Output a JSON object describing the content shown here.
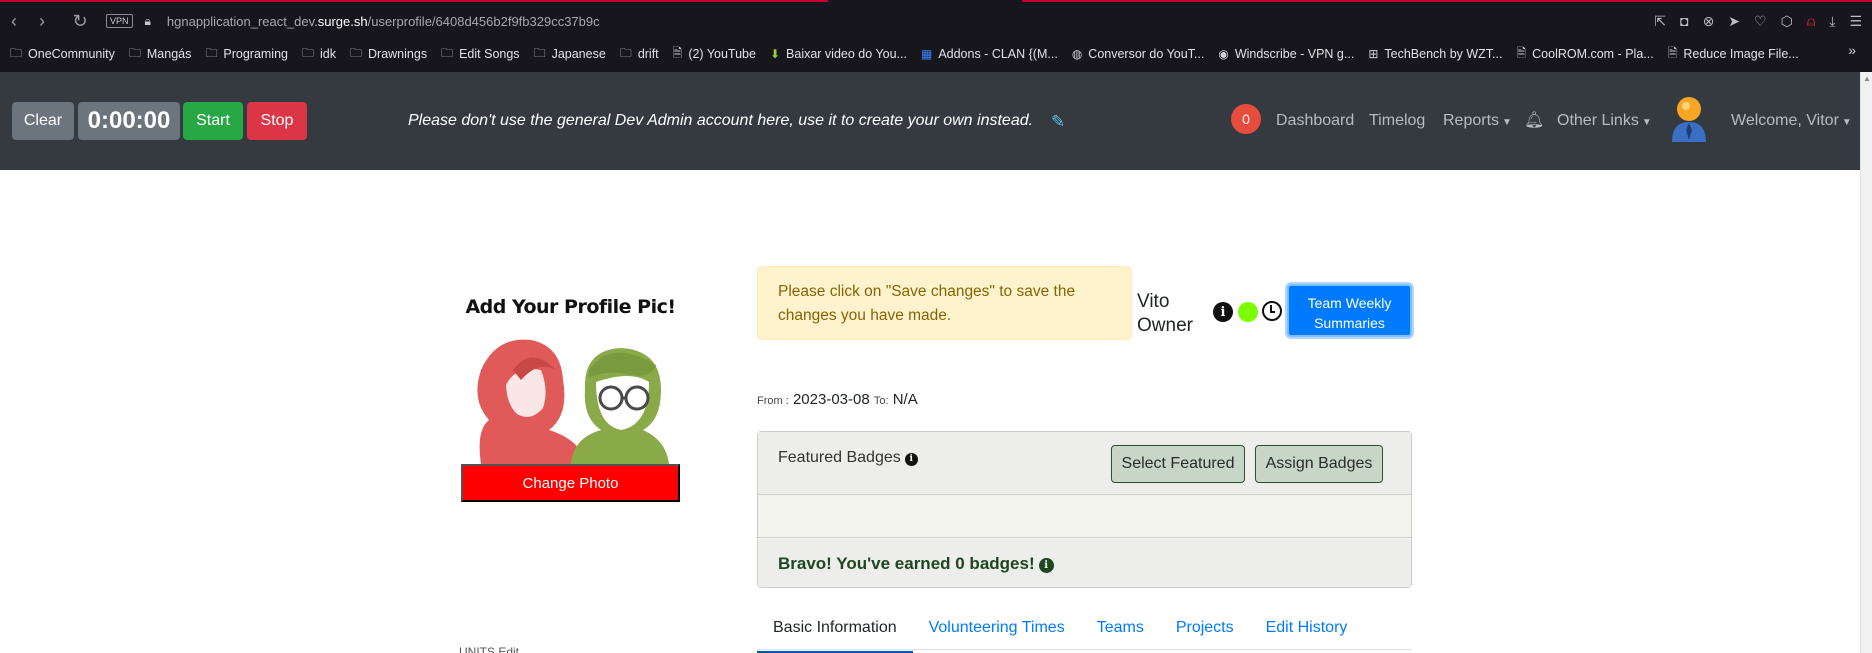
{
  "browser": {
    "url_host_prefix": "hgnapplication_react_dev.",
    "url_host": "surge.sh",
    "url_path": "/userprofile/6408d456b2f9fb329cc37b9c",
    "vpn_label": "VPN",
    "bookmarks": [
      {
        "label": "OneCommunity",
        "icon": "folder-icon"
      },
      {
        "label": "Mangás",
        "icon": "folder-icon"
      },
      {
        "label": "Programing",
        "icon": "folder-icon"
      },
      {
        "label": "idk",
        "icon": "folder-icon"
      },
      {
        "label": "Drawnings",
        "icon": "folder-icon"
      },
      {
        "label": "Edit Songs",
        "icon": "folder-icon"
      },
      {
        "label": "Japanese",
        "icon": "folder-icon"
      },
      {
        "label": "drift",
        "icon": "folder-icon"
      },
      {
        "label": "(2) YouTube",
        "icon": "page-icon"
      },
      {
        "label": "Baixar video do You...",
        "icon": "download-arrow-icon"
      },
      {
        "label": "Addons - CLAN {(M...",
        "icon": "calendar-icon"
      },
      {
        "label": "Conversor do YouT...",
        "icon": "swirl-icon"
      },
      {
        "label": "Windscribe - VPN g...",
        "icon": "windscribe-icon"
      },
      {
        "label": "TechBench by WZT...",
        "icon": "windows-icon"
      },
      {
        "label": "CoolROM.com - Pla...",
        "icon": "page-icon"
      },
      {
        "label": "Reduce Image File...",
        "icon": "page-icon"
      }
    ]
  },
  "header": {
    "clear_label": "Clear",
    "timer": "0:00:00",
    "start_label": "Start",
    "stop_label": "Stop",
    "notice": "Please don't use the general Dev Admin account here, use it to create your own instead.",
    "notification_count": "0",
    "dashboard": "Dashboard",
    "timelog": "Timelog",
    "reports": "Reports",
    "other_links": "Other Links",
    "welcome": "Welcome, Vitor"
  },
  "profile": {
    "pic_title": "Add Your Profile Pic!",
    "change_photo": "Change Photo",
    "alert": "Please click on \"Save changes\" to save the changes you have made.",
    "first_name": "Vito",
    "last_name": "Owner",
    "team_weekly_line1": "Team Weekly",
    "team_weekly_line2": "Summaries",
    "from_label": "From :",
    "from_date": "2023-03-08",
    "to_label": "To:",
    "to_value": "N/A",
    "status_color": "#7cfc00"
  },
  "badges": {
    "title": "Featured Badges",
    "select_featured": "Select Featured",
    "assign_badges": "Assign Badges",
    "bravo": "Bravo! You've earned 0 badges!"
  },
  "tabs": [
    {
      "label": "Basic Information",
      "active": true
    },
    {
      "label": "Volunteering Times",
      "active": false
    },
    {
      "label": "Teams",
      "active": false
    },
    {
      "label": "Projects",
      "active": false
    },
    {
      "label": "Edit History",
      "active": false
    }
  ],
  "partial_text": "UNITS   Edit"
}
